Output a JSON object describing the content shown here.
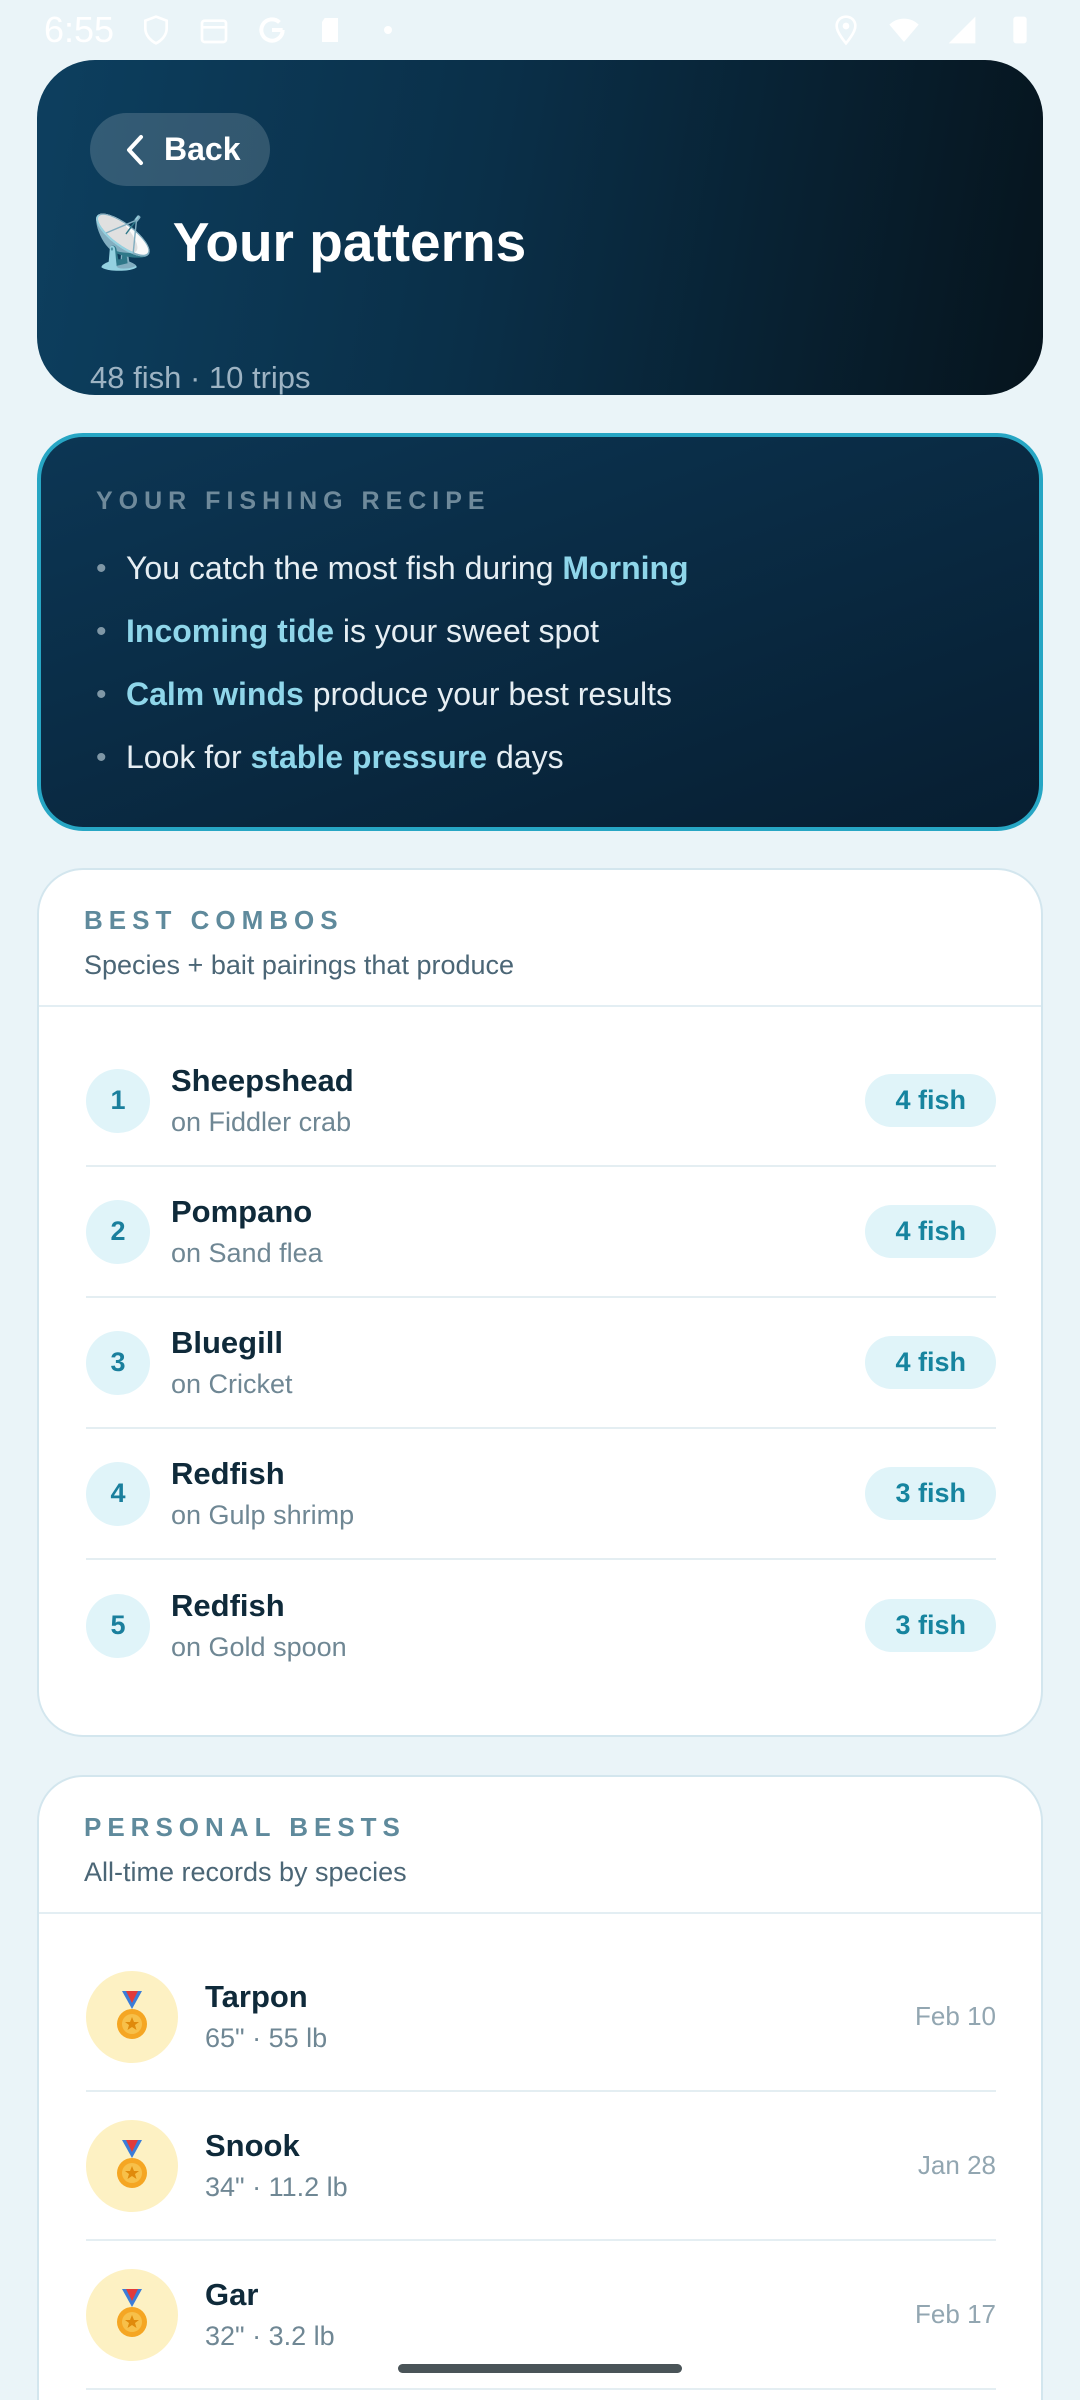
{
  "status_bar": {
    "time": "6:55",
    "icons": [
      "shield-icon",
      "calendar-icon",
      "google-icon",
      "sd-card-icon",
      "dot-icon",
      "location-icon",
      "wifi-icon",
      "signal-icon",
      "battery-icon"
    ]
  },
  "header": {
    "back_label": "Back",
    "emoji": "📡",
    "title": "Your patterns",
    "subtitle": "48 fish · 10 trips"
  },
  "recipe": {
    "heading": "YOUR FISHING RECIPE",
    "items": [
      {
        "before": "You catch the most fish during ",
        "highlight": "Morning",
        "after": ""
      },
      {
        "before": "",
        "highlight": "Incoming tide",
        "after": " is your sweet spot"
      },
      {
        "before": "",
        "highlight": "Calm winds",
        "after": " produce your best results"
      },
      {
        "before": "Look for ",
        "highlight": "stable pressure",
        "after": " days"
      }
    ]
  },
  "combos": {
    "heading": "BEST COMBOS",
    "subtitle": "Species + bait pairings that produce",
    "rows": [
      {
        "rank": "1",
        "species": "Sheepshead",
        "bait": "on Fiddler crab",
        "count": "4 fish"
      },
      {
        "rank": "2",
        "species": "Pompano",
        "bait": "on Sand flea",
        "count": "4 fish"
      },
      {
        "rank": "3",
        "species": "Bluegill",
        "bait": "on Cricket",
        "count": "4 fish"
      },
      {
        "rank": "4",
        "species": "Redfish",
        "bait": "on Gulp shrimp",
        "count": "3 fish"
      },
      {
        "rank": "5",
        "species": "Redfish",
        "bait": "on Gold spoon",
        "count": "3 fish"
      }
    ]
  },
  "bests": {
    "heading": "PERSONAL BESTS",
    "subtitle": "All-time records by species",
    "rows": [
      {
        "species": "Tarpon",
        "meta": "65\" · 55 lb",
        "date": "Feb 10"
      },
      {
        "species": "Snook",
        "meta": "34\" · 11.2 lb",
        "date": "Jan 28"
      },
      {
        "species": "Gar",
        "meta": "32\" · 3.2 lb",
        "date": "Feb 17"
      }
    ]
  },
  "colors": {
    "accent": "#16849f",
    "highlight": "#8fd6ea",
    "header_dark": "#0a2f48"
  }
}
